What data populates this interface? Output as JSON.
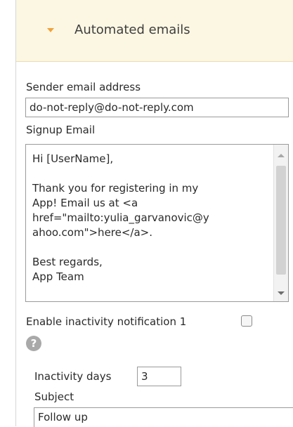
{
  "header": {
    "title": "Automated emails",
    "caret_color": "#f0a23c",
    "background": "#fcf7e3"
  },
  "sender": {
    "label": "Sender email address",
    "value": "do-not-reply@do-not-reply.com"
  },
  "signup": {
    "label": "Signup Email",
    "body": "Hi [UserName],\n\nThank you for registering in my\nApp! Email us at <a\nhref=\"mailto:yulia_garvanovic@y\nahoo.com\">here</a>.\n\nBest regards,\nApp Team"
  },
  "inactivity": {
    "enable_label": "Enable inactivity notification 1",
    "enabled": false,
    "help_icon": "?",
    "days_label": "Inactivity days",
    "days_value": "3",
    "subject_label": "Subject",
    "subject_value": "Follow up"
  }
}
